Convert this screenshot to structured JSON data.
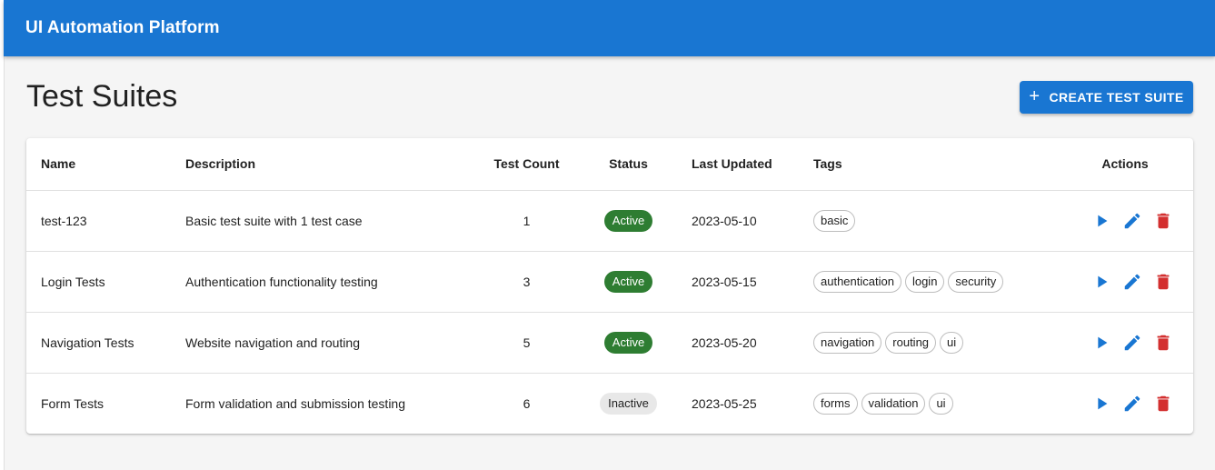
{
  "app": {
    "title": "UI Automation Platform"
  },
  "page": {
    "title": "Test Suites",
    "create_label": "CREATE TEST SUITE",
    "create_icon": "+"
  },
  "table": {
    "headers": {
      "name": "Name",
      "description": "Description",
      "test_count": "Test Count",
      "status": "Status",
      "last_updated": "Last Updated",
      "tags": "Tags",
      "actions": "Actions"
    },
    "rows": [
      {
        "name": "test-123",
        "description": "Basic test suite with 1 test case",
        "test_count": "1",
        "status": "Active",
        "last_updated": "2023-05-10",
        "tags": [
          "basic"
        ]
      },
      {
        "name": "Login Tests",
        "description": "Authentication functionality testing",
        "test_count": "3",
        "status": "Active",
        "last_updated": "2023-05-15",
        "tags": [
          "authentication",
          "login",
          "security"
        ]
      },
      {
        "name": "Navigation Tests",
        "description": "Website navigation and routing",
        "test_count": "5",
        "status": "Active",
        "last_updated": "2023-05-20",
        "tags": [
          "navigation",
          "routing",
          "ui"
        ]
      },
      {
        "name": "Form Tests",
        "description": "Form validation and submission testing",
        "test_count": "6",
        "status": "Inactive",
        "last_updated": "2023-05-25",
        "tags": [
          "forms",
          "validation",
          "ui"
        ]
      }
    ]
  },
  "colors": {
    "primary": "#1976d2",
    "active": "#2e7d32",
    "delete": "#d32f2f",
    "inactive_bg": "#e8e8e8"
  },
  "icons": {
    "run": "play-icon",
    "edit": "pencil-icon",
    "delete": "trash-icon"
  }
}
